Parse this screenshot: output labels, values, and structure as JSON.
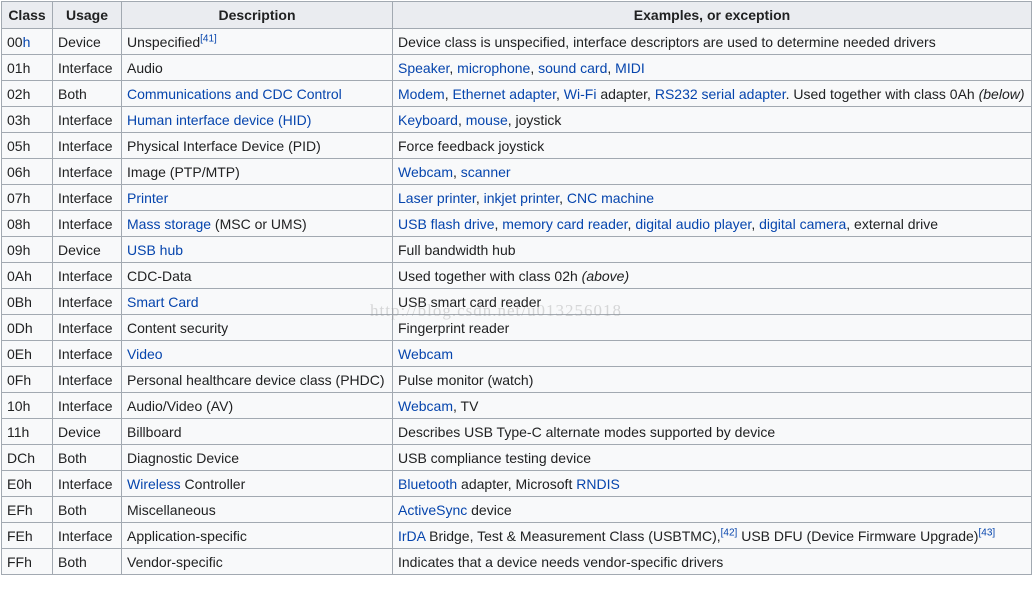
{
  "colors": {
    "link": "#0645ad",
    "text": "#202122",
    "header_bg": "#eaecf0",
    "cell_bg": "#f8f9fa",
    "border": "#a2a9b1"
  },
  "headers": [
    "Class",
    "Usage",
    "Description",
    "Examples, or exception"
  ],
  "watermark": "http://blog.csdn.net/u013256018",
  "rows": [
    {
      "class": [
        {
          "t": "00"
        },
        {
          "t": "h",
          "link": true
        }
      ],
      "usage": "Device",
      "desc": [
        {
          "t": "Unspecified"
        },
        {
          "t": "[41]",
          "sup": true,
          "link": true
        }
      ],
      "ex": [
        {
          "t": "Device class is unspecified, interface descriptors are used to determine needed drivers"
        }
      ]
    },
    {
      "class": [
        {
          "t": "01h"
        }
      ],
      "usage": "Interface",
      "desc": [
        {
          "t": "Audio"
        }
      ],
      "ex": [
        {
          "t": "Speaker",
          "link": true
        },
        {
          "t": ", "
        },
        {
          "t": "microphone",
          "link": true
        },
        {
          "t": ", "
        },
        {
          "t": "sound card",
          "link": true
        },
        {
          "t": ", "
        },
        {
          "t": "MIDI",
          "link": true
        }
      ]
    },
    {
      "class": [
        {
          "t": "02h"
        }
      ],
      "usage": "Both",
      "desc": [
        {
          "t": "Communications and CDC Control",
          "link": true
        }
      ],
      "ex": [
        {
          "t": "Modem",
          "link": true
        },
        {
          "t": ", "
        },
        {
          "t": "Ethernet adapter",
          "link": true
        },
        {
          "t": ", "
        },
        {
          "t": "Wi-Fi",
          "link": true
        },
        {
          "t": " adapter, "
        },
        {
          "t": "RS232 serial adapter",
          "link": true
        },
        {
          "t": ". Used together with class 0Ah "
        },
        {
          "t": "(below)",
          "italic": true
        }
      ]
    },
    {
      "class": [
        {
          "t": "03h"
        }
      ],
      "usage": "Interface",
      "desc": [
        {
          "t": "Human interface device (HID)",
          "link": true
        }
      ],
      "ex": [
        {
          "t": "Keyboard",
          "link": true
        },
        {
          "t": ", "
        },
        {
          "t": "mouse",
          "link": true
        },
        {
          "t": ", joystick"
        }
      ]
    },
    {
      "class": [
        {
          "t": "05h"
        }
      ],
      "usage": "Interface",
      "desc": [
        {
          "t": "Physical Interface Device (PID)"
        }
      ],
      "ex": [
        {
          "t": "Force feedback joystick"
        }
      ]
    },
    {
      "class": [
        {
          "t": "06h"
        }
      ],
      "usage": "Interface",
      "desc": [
        {
          "t": "Image (PTP/MTP)"
        }
      ],
      "ex": [
        {
          "t": "Webcam",
          "link": true
        },
        {
          "t": ", "
        },
        {
          "t": "scanner",
          "link": true
        }
      ]
    },
    {
      "class": [
        {
          "t": "07h"
        }
      ],
      "usage": "Interface",
      "desc": [
        {
          "t": "Printer",
          "link": true
        }
      ],
      "ex": [
        {
          "t": "Laser printer",
          "link": true
        },
        {
          "t": ", "
        },
        {
          "t": "inkjet printer",
          "link": true
        },
        {
          "t": ", "
        },
        {
          "t": "CNC machine",
          "link": true
        }
      ]
    },
    {
      "class": [
        {
          "t": "08h"
        }
      ],
      "usage": "Interface",
      "desc": [
        {
          "t": "Mass storage",
          "link": true
        },
        {
          "t": " (MSC or UMS)"
        }
      ],
      "ex": [
        {
          "t": "USB flash drive",
          "link": true
        },
        {
          "t": ", "
        },
        {
          "t": "memory card reader",
          "link": true
        },
        {
          "t": ", "
        },
        {
          "t": "digital audio player",
          "link": true
        },
        {
          "t": ", "
        },
        {
          "t": "digital camera",
          "link": true
        },
        {
          "t": ", external drive"
        }
      ]
    },
    {
      "class": [
        {
          "t": "09h"
        }
      ],
      "usage": "Device",
      "desc": [
        {
          "t": "USB hub",
          "link": true
        }
      ],
      "ex": [
        {
          "t": "Full bandwidth hub"
        }
      ]
    },
    {
      "class": [
        {
          "t": "0Ah"
        }
      ],
      "usage": "Interface",
      "desc": [
        {
          "t": "CDC-Data"
        }
      ],
      "ex": [
        {
          "t": "Used together with class 02h "
        },
        {
          "t": "(above)",
          "italic": true
        }
      ]
    },
    {
      "class": [
        {
          "t": "0Bh"
        }
      ],
      "usage": "Interface",
      "desc": [
        {
          "t": "Smart Card",
          "link": true
        }
      ],
      "ex": [
        {
          "t": "USB smart card reader"
        }
      ]
    },
    {
      "class": [
        {
          "t": "0Dh"
        }
      ],
      "usage": "Interface",
      "desc": [
        {
          "t": "Content security"
        }
      ],
      "ex": [
        {
          "t": "Fingerprint reader"
        }
      ]
    },
    {
      "class": [
        {
          "t": "0Eh"
        }
      ],
      "usage": "Interface",
      "desc": [
        {
          "t": "Video",
          "link": true
        }
      ],
      "ex": [
        {
          "t": "Webcam",
          "link": true
        }
      ]
    },
    {
      "class": [
        {
          "t": "0Fh"
        }
      ],
      "usage": "Interface",
      "desc": [
        {
          "t": "Personal healthcare device class (PHDC)"
        }
      ],
      "ex": [
        {
          "t": "Pulse monitor (watch)"
        }
      ]
    },
    {
      "class": [
        {
          "t": "10h"
        }
      ],
      "usage": "Interface",
      "desc": [
        {
          "t": "Audio/Video (AV)"
        }
      ],
      "ex": [
        {
          "t": "Webcam",
          "link": true
        },
        {
          "t": ", TV"
        }
      ]
    },
    {
      "class": [
        {
          "t": "11h"
        }
      ],
      "usage": "Device",
      "desc": [
        {
          "t": "Billboard"
        }
      ],
      "ex": [
        {
          "t": "Describes USB Type-C alternate modes supported by device"
        }
      ]
    },
    {
      "class": [
        {
          "t": "DCh"
        }
      ],
      "usage": "Both",
      "desc": [
        {
          "t": "Diagnostic Device"
        }
      ],
      "ex": [
        {
          "t": "USB compliance testing device"
        }
      ]
    },
    {
      "class": [
        {
          "t": "E0h"
        }
      ],
      "usage": "Interface",
      "desc": [
        {
          "t": "Wireless",
          "link": true
        },
        {
          "t": " Controller"
        }
      ],
      "ex": [
        {
          "t": "Bluetooth",
          "link": true
        },
        {
          "t": " adapter, Microsoft "
        },
        {
          "t": "RNDIS",
          "link": true
        }
      ]
    },
    {
      "class": [
        {
          "t": "EFh"
        }
      ],
      "usage": "Both",
      "desc": [
        {
          "t": "Miscellaneous"
        }
      ],
      "ex": [
        {
          "t": "ActiveSync",
          "link": true
        },
        {
          "t": " device"
        }
      ]
    },
    {
      "class": [
        {
          "t": "FEh"
        }
      ],
      "usage": "Interface",
      "desc": [
        {
          "t": "Application-specific"
        }
      ],
      "ex": [
        {
          "t": "IrDA",
          "link": true
        },
        {
          "t": " Bridge, Test & Measurement Class (USBTMC),"
        },
        {
          "t": "[42]",
          "sup": true,
          "link": true
        },
        {
          "t": " USB DFU (Device Firmware Upgrade)"
        },
        {
          "t": "[43]",
          "sup": true,
          "link": true
        }
      ]
    },
    {
      "class": [
        {
          "t": "FFh"
        }
      ],
      "usage": "Both",
      "desc": [
        {
          "t": "Vendor-specific"
        }
      ],
      "ex": [
        {
          "t": "Indicates that a device needs vendor-specific drivers"
        }
      ]
    }
  ]
}
